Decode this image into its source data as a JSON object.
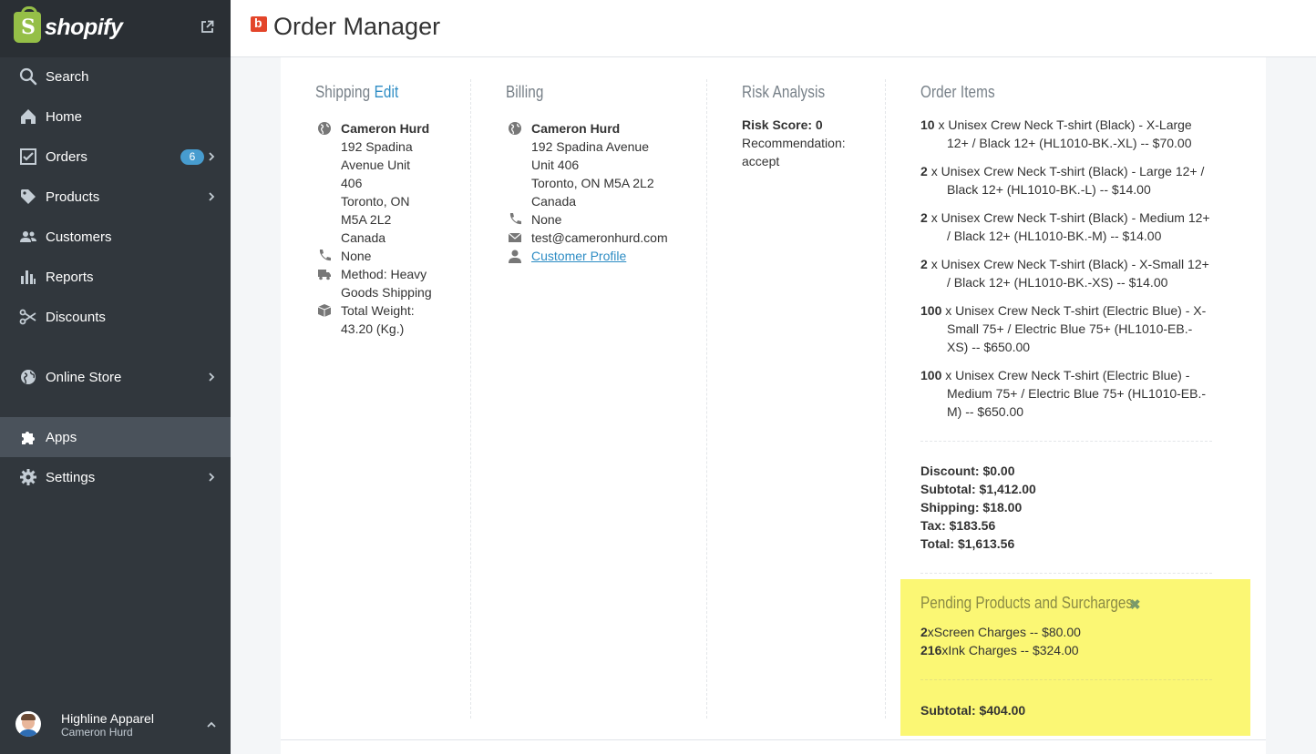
{
  "sidebar": {
    "brand": "shopify",
    "logo_letter": "S",
    "items": [
      {
        "label": "Search"
      },
      {
        "label": "Home"
      },
      {
        "label": "Orders",
        "badge": "6"
      },
      {
        "label": "Products"
      },
      {
        "label": "Customers"
      },
      {
        "label": "Reports"
      },
      {
        "label": "Discounts"
      },
      {
        "label": "Online Store"
      },
      {
        "label": "Apps"
      },
      {
        "label": "Settings"
      }
    ],
    "store_name": "Highline Apparel",
    "user_name": "Cameron Hurd"
  },
  "header": {
    "app_icon_letter": "b",
    "title": "Order Manager"
  },
  "shipping": {
    "title": "Shipping",
    "edit_label": "Edit",
    "name": "Cameron Hurd",
    "address_lines": [
      "192 Spadina",
      "Avenue Unit",
      "406",
      "Toronto, ON",
      "M5A 2L2",
      "Canada"
    ],
    "phone": "None",
    "method_lines": [
      "Method: Heavy",
      "Goods Shipping"
    ],
    "weight_lines": [
      "Total Weight:",
      "43.20 (Kg.)"
    ]
  },
  "billing": {
    "title": "Billing",
    "name": "Cameron Hurd",
    "address_lines": [
      "192 Spadina Avenue",
      "Unit 406",
      "Toronto, ON M5A 2L2",
      "Canada"
    ],
    "phone": "None",
    "email": "test@cameronhurd.com",
    "profile_link": "Customer Profile"
  },
  "risk": {
    "title": "Risk Analysis",
    "score": "Risk Score: 0",
    "recommendation_label": "Recommendation:",
    "recommendation_value": "accept"
  },
  "order_items": {
    "title": "Order Items",
    "items": [
      {
        "qty": "10",
        "desc": "x Unisex Crew Neck T-shirt (Black) - X-Large 12+ / Black 12+ (HL1010-BK.-XL) -- $70.00"
      },
      {
        "qty": "2",
        "desc": "x Unisex Crew Neck T-shirt (Black) - Large 12+ / Black 12+ (HL1010-BK.-L) -- $14.00"
      },
      {
        "qty": "2",
        "desc": "x Unisex Crew Neck T-shirt (Black) - Medium 12+ / Black 12+ (HL1010-BK.-M) -- $14.00"
      },
      {
        "qty": "2",
        "desc": "x Unisex Crew Neck T-shirt (Black) - X-Small 12+ / Black 12+ (HL1010-BK.-XS) -- $14.00"
      },
      {
        "qty": "100",
        "desc": "x Unisex Crew Neck T-shirt (Electric Blue) - X-Small 75+ / Electric Blue 75+ (HL1010-EB.-XS) -- $650.00"
      },
      {
        "qty": "100",
        "desc": "x Unisex Crew Neck T-shirt (Electric Blue) - Medium 75+ / Electric Blue 75+ (HL1010-EB.-M) -- $650.00"
      }
    ],
    "discount": "Discount: $0.00",
    "subtotal": "Subtotal: $1,412.00",
    "shipping": "Shipping: $18.00",
    "tax": "Tax: $183.56",
    "total": "Total: $1,613.56"
  },
  "pending": {
    "title": "Pending Products and Surcharges",
    "close_glyph": "✖",
    "items": [
      {
        "qty": "2",
        "desc": "xScreen Charges -- $80.00"
      },
      {
        "qty": "216",
        "desc": "xInk Charges -- $324.00"
      }
    ],
    "subtotal": "Subtotal: $404.00"
  },
  "colors": {
    "sidebar_bg": "#31373d",
    "accent": "#479ccf",
    "link": "#2d8cc4",
    "highlight": "#fbf774",
    "brand_green": "#95bf47",
    "app_icon": "#e3452a"
  }
}
